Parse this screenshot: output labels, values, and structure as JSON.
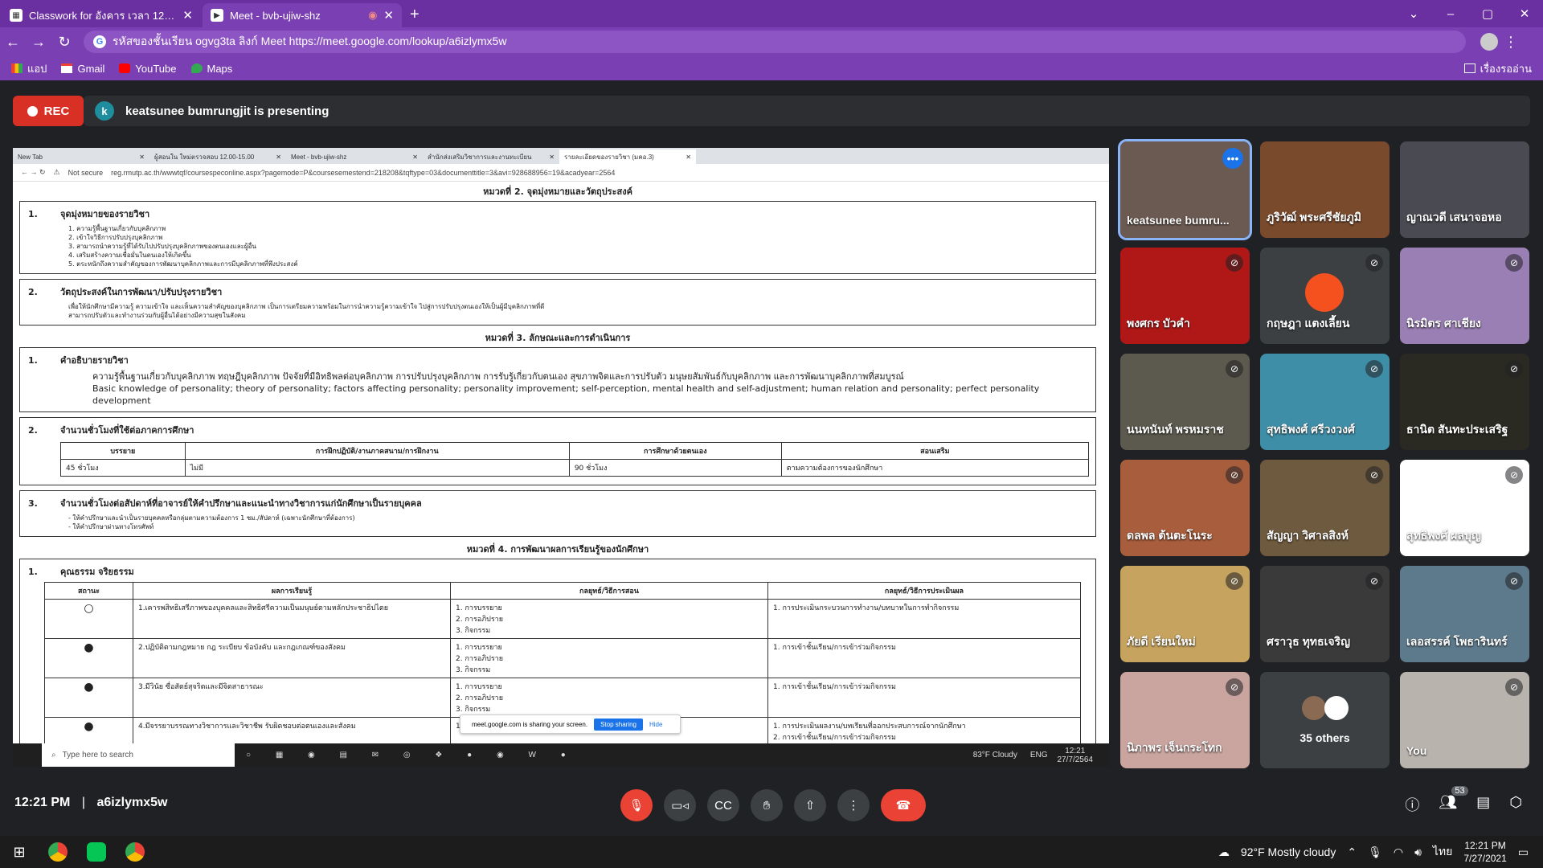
{
  "browser": {
    "tabs": [
      {
        "title": "Classwork for อังคาร เวลา 12.00-15.00",
        "active": false
      },
      {
        "title": "Meet - bvb-ujiw-shz",
        "active": true
      }
    ],
    "address": "รหัสของชั้นเรียน ogvg3ta ลิงก์ Meet https://meet.google.com/lookup/a6izlymx5w",
    "bookmarks": [
      "แอป",
      "Gmail",
      "YouTube",
      "Maps"
    ],
    "reading_list": "เรื่องรออ่าน"
  },
  "meet": {
    "rec_label": "REC",
    "presenter_initial": "k",
    "presenting_text": "keatsunee bumrungjit is presenting",
    "time": "12:21 PM",
    "separator": "|",
    "meeting_code": "a6izlymx5w",
    "participants_count": "53",
    "participants": [
      {
        "name": "keatsunee bumru...",
        "speaking": true,
        "muted": false
      },
      {
        "name": "ภูริวัฒ์ พระศรีชัยภูมิ",
        "muted": false
      },
      {
        "name": "ญาณวดี เสนาจอหอ",
        "muted": false
      },
      {
        "name": "พงศกร บัวคำ",
        "muted": true
      },
      {
        "name": "กฤษฎา แตงเลี้ยน",
        "muted": true
      },
      {
        "name": "นิรมิตร ศาเชียง",
        "muted": true
      },
      {
        "name": "นนทนันท์ พรหมราช",
        "muted": true
      },
      {
        "name": "สุทธิพงศ์ ศรีวงวงศ์",
        "muted": true
      },
      {
        "name": "ธานิต สันทะประเสริฐ",
        "muted": true
      },
      {
        "name": "ดลพล ต้นตะโนระ",
        "muted": true
      },
      {
        "name": "สัญญา วิศาลสิงห์",
        "muted": true
      },
      {
        "name": "สุทธิพงศ์ ผลบุญ",
        "muted": true
      },
      {
        "name": "ภัยดี เรียนใหม่",
        "muted": true
      },
      {
        "name": "ศราวุธ ทุทธเจริญ",
        "muted": true
      },
      {
        "name": "เลอสรรค์ โพธารินทร์",
        "muted": true
      },
      {
        "name": "นิภาพร เจ็นกระโทก",
        "muted": true
      },
      {
        "name": "35 others",
        "muted": false
      },
      {
        "name": "You",
        "muted": true
      }
    ]
  },
  "shared": {
    "tabs": [
      "New Tab",
      "ผู้สอนใน ใหม่ตรวจสอบ 12.00-15.00",
      "Meet - bvb-ujiw-shz",
      "สำนักส่งเสริมวิชาการและงานทะเบียน",
      "รายละเอียดของรายวิชา (มคอ.3)"
    ],
    "url": "reg.rmutp.ac.th/wwwtqf/coursespeconline.aspx?pagemode=P&coursesemestend=218208&tqftype=03&documenttitle=3&avi=928688956=19&acadyear=2564",
    "not_secure": "Not secure",
    "section2": "หมวดที่ 2. จุดมุ่งหมายและวัตถุประสงค์",
    "s2_1": "จุดมุ่งหมายของรายวิชา",
    "s2_1_lines": [
      "1. ความรู้พื้นฐานเกี่ยวกับบุคลิกภาพ",
      "2. เข้าใจวิธีการปรับปรุงบุคลิกภาพ",
      "3. สามารถนำความรู้ที่ได้รับไปปรับปรุงบุคลิกภาพของตนเองและผู้อื่น",
      "4. เสริมสร้างความเชื่อมั่นในตนเองให้เกิดขึ้น",
      "5. ตระหนักถึงความสำคัญของการพัฒนาบุคลิกภาพและการมีบุคลิกภาพที่พึงประสงค์"
    ],
    "s2_2": "วัตถุประสงค์ในการพัฒนา/ปรับปรุงรายวิชา",
    "s2_2_lines": [
      "เพื่อให้นักศึกษามีความรู้ ความเข้าใจ และเห็นความสำคัญของบุคลิกภาพ เป็นการเตรียมความพร้อมในการนำความรู้ความเข้าใจ ไปสู่การปรับปรุงตนเองให้เป็นผู้มีบุคลิกภาพที่ดี",
      "สามารถปรับตัวและทำงานร่วมกับผู้อื่นได้อย่างมีความสุขในสังคม"
    ],
    "section3": "หมวดที่ 3. ลักษณะและการดำเนินการ",
    "s3_1": "คำอธิบายรายวิชา",
    "s3_1_th": "ความรู้พื้นฐานเกี่ยวกับบุคลิกภาพ ทฤษฎีบุคลิกภาพ ปัจจัยที่มีอิทธิพลต่อบุคลิกภาพ การปรับปรุงบุคลิกภาพ การรับรู้เกี่ยวกับตนเอง สุขภาพจิตและการปรับตัว มนุษยสัมพันธ์กับบุคลิกภาพ และการพัฒนาบุคลิกภาพที่สมบูรณ์",
    "s3_1_en": "Basic knowledge of personality; theory of personality; factors affecting personality; personality improvement; self-perception, mental health and self-adjustment; human relation and personality; perfect personality development",
    "s3_2": "จำนวนชั่วโมงที่ใช้ต่อภาคการศึกษา",
    "hours_head": [
      "บรรยาย",
      "การฝึกปฏิบัติ/งานภาคสนาม/การฝึกงาน",
      "การศึกษาด้วยตนเอง",
      "สอนเสริม"
    ],
    "hours_row": [
      "45 ชั่วโมง",
      "ไม่มี",
      "90 ชั่วโมง",
      "ตามความต้องการของนักศึกษา"
    ],
    "s3_3": "จำนวนชั่วโมงต่อสัปดาห์ที่อาจารย์ให้คำปรึกษาและแนะนำทางวิชาการแก่นักศึกษาเป็นรายบุคคล",
    "s3_3_lines": [
      "- ให้คำปรึกษาและนำเป็นรายบุคคลหรือกลุ่มตามความต้องการ 1 ชม./สัปดาห์ (เฉพาะนักศึกษาที่ต้องการ)",
      "- ให้คำปรึกษาผ่านทางโทรศัพท์"
    ],
    "section4": "หมวดที่ 4. การพัฒนาผลการเรียนรู้ของนักศึกษา",
    "s4_1": "คุณธรรม จริยธรรม",
    "lo_head": [
      "สถานะ",
      "ผลการเรียนรู้",
      "กลยุทธ์/วิธีการสอน",
      "กลยุทธ์/วิธีการประเมินผล"
    ],
    "lo_rows": [
      {
        "status": "○",
        "outcome": "1.เคารพสิทธิเสรีภาพของบุคคลและสิทธิศรีความเป็นมนุษย์ตามหลักประชาธิปไตย",
        "teach": [
          "1. การบรรยาย",
          "2. การอภิปราย",
          "3. กิจกรรม"
        ],
        "eval": [
          "1. การประเมินกระบวนการทำงาน/บทบาทในการทำกิจกรรม"
        ]
      },
      {
        "status": "●",
        "outcome": "2.ปฏิบัติตามกฎหมาย กฎ ระเบียบ ข้อบังคับ และกฎเกณฑ์ของสังคม",
        "teach": [
          "1. การบรรยาย",
          "2. การอภิปราย",
          "3. กิจกรรม"
        ],
        "eval": [
          "1. การเข้าชั้นเรียน/การเข้าร่วมกิจกรรม"
        ]
      },
      {
        "status": "●",
        "outcome": "3.มีวินัย ซื่อสัตย์สุจริตและมีจิตสาธารณะ",
        "teach": [
          "1. การบรรยาย",
          "2. การอภิปราย",
          "3. กิจกรรม"
        ],
        "eval": [
          "1. การเข้าชั้นเรียน/การเข้าร่วมกิจกรรม"
        ]
      },
      {
        "status": "●",
        "outcome": "4.มีจรรยาบรรณทางวิชาการและวิชาชีพ รับผิดชอบต่อตนเองและสังคม",
        "teach": [
          "1. การบรรยาย"
        ],
        "eval": [
          "1. การประเมินผลงาน/บทเรียนที่ออกประสบการณ์จากนักศึกษา",
          "2. การเข้าชั้นเรียน/การเข้าร่วมกิจกรรม"
        ]
      }
    ],
    "share_notice": "meet.google.com is sharing your screen.",
    "stop_sharing": "Stop sharing",
    "hide": "Hide",
    "taskbar_search": "Type here to search",
    "taskbar_weather": "83°F  Cloudy",
    "taskbar_lang": "ENG",
    "taskbar_time": "12:21",
    "taskbar_date": "27/7/2564"
  },
  "windows": {
    "weather": "92°F  Mostly cloudy",
    "lang": "ไทย",
    "time": "12:21 PM",
    "date": "7/27/2021"
  },
  "colors": {
    "accent_purple": "#7b3fb4",
    "rec_red": "#d93025",
    "meet_bg": "#202124"
  }
}
